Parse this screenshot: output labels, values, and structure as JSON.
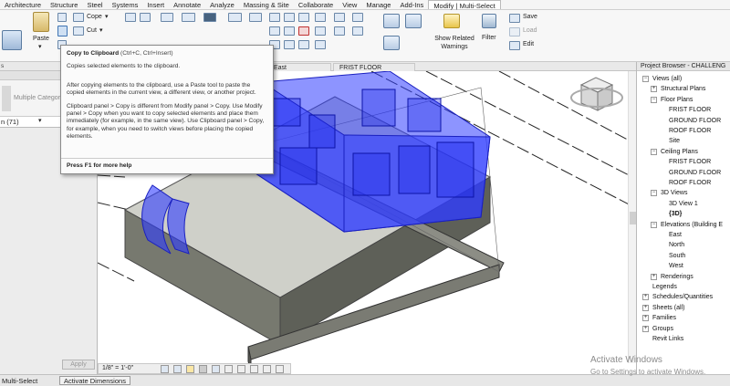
{
  "menu_tabs": [
    "Architecture",
    "Structure",
    "Steel",
    "Systems",
    "Insert",
    "Annotate",
    "Analyze",
    "Massing & Site",
    "Collaborate",
    "View",
    "Manage",
    "Add-Ins",
    "Modify | Multi-Select"
  ],
  "ribbon": {
    "paste_label": "Paste",
    "cope_label": "Cope",
    "cut_label": "Cut",
    "show_related_warnings": "Show Related Warnings",
    "filter_label": "Filter",
    "save_label": "Save",
    "load_label": "Load",
    "edit_label": "Edit"
  },
  "panel_labels": {
    "select": "s"
  },
  "properties": {
    "type_label": "Multiple Categories Selected",
    "filter_value": "n (71)",
    "apply_label": "Apply"
  },
  "view_tabs": {
    "east": "East",
    "first_floor": "FRIST FLOOR"
  },
  "tooltip": {
    "title": "Copy to Clipboard",
    "shortcut": "(Ctrl+C, Ctrl+Insert)",
    "summary": "Copies selected elements to the clipboard.",
    "para1": "After copying elements to the clipboard, use a Paste tool to paste the copied elements in the current view, a different view, or another project.",
    "para2": "Clipboard panel > Copy is different from Modify panel > Copy. Use Modify panel > Copy when you want to copy selected elements and place them immediately (for example, in the same view). Use Clipboard panel > Copy, for example, when you need to switch views before placing the copied elements.",
    "footer": "Press F1 for more help"
  },
  "project_browser": {
    "title": "Project Browser - CHALLENG",
    "nodes": [
      {
        "label": "Views (all)",
        "level": 0,
        "expander": "-"
      },
      {
        "label": "Structural Plans",
        "level": 1,
        "expander": "+"
      },
      {
        "label": "Floor Plans",
        "level": 1,
        "expander": "-"
      },
      {
        "label": "FRIST FLOOR",
        "level": 2,
        "expander": ""
      },
      {
        "label": "GROUND FLOOR",
        "level": 2,
        "expander": ""
      },
      {
        "label": "ROOF FLOOR",
        "level": 2,
        "expander": ""
      },
      {
        "label": "Site",
        "level": 2,
        "expander": ""
      },
      {
        "label": "Ceiling Plans",
        "level": 1,
        "expander": "-"
      },
      {
        "label": "FRIST FLOOR",
        "level": 2,
        "expander": ""
      },
      {
        "label": "GROUND FLOOR",
        "level": 2,
        "expander": ""
      },
      {
        "label": "ROOF FLOOR",
        "level": 2,
        "expander": ""
      },
      {
        "label": "3D Views",
        "level": 1,
        "expander": "-"
      },
      {
        "label": "3D View 1",
        "level": 2,
        "expander": ""
      },
      {
        "label": "{3D}",
        "level": 2,
        "expander": ""
      },
      {
        "label": "Elevations (Building E",
        "level": 1,
        "expander": "-"
      },
      {
        "label": "East",
        "level": 2,
        "expander": ""
      },
      {
        "label": "North",
        "level": 2,
        "expander": ""
      },
      {
        "label": "South",
        "level": 2,
        "expander": ""
      },
      {
        "label": "West",
        "level": 2,
        "expander": ""
      },
      {
        "label": "Renderings",
        "level": 1,
        "expander": "+"
      },
      {
        "label": "Legends",
        "level": 0,
        "expander": ""
      },
      {
        "label": "Schedules/Quantities",
        "level": 0,
        "expander": "+"
      },
      {
        "label": "Sheets (all)",
        "level": 0,
        "expander": "+"
      },
      {
        "label": "Families",
        "level": 0,
        "expander": "+"
      },
      {
        "label": "Groups",
        "level": 0,
        "expander": "+"
      },
      {
        "label": "Revit Links",
        "level": 0,
        "expander": ""
      }
    ]
  },
  "view_control": {
    "scale": "1/8\" = 1'-0\""
  },
  "status": {
    "mode": "Multi-Select",
    "activate_dimensions": "Activate Dimensions"
  },
  "watermark": {
    "line1": "Activate Windows",
    "line2": "Go to Settings to activate Windows."
  },
  "viewcube": {
    "face_label": "FRONT"
  },
  "colors": {
    "selection_blue": "#2f3cff",
    "ground": "#7d7f75",
    "accent_tab": "#ffffff"
  }
}
